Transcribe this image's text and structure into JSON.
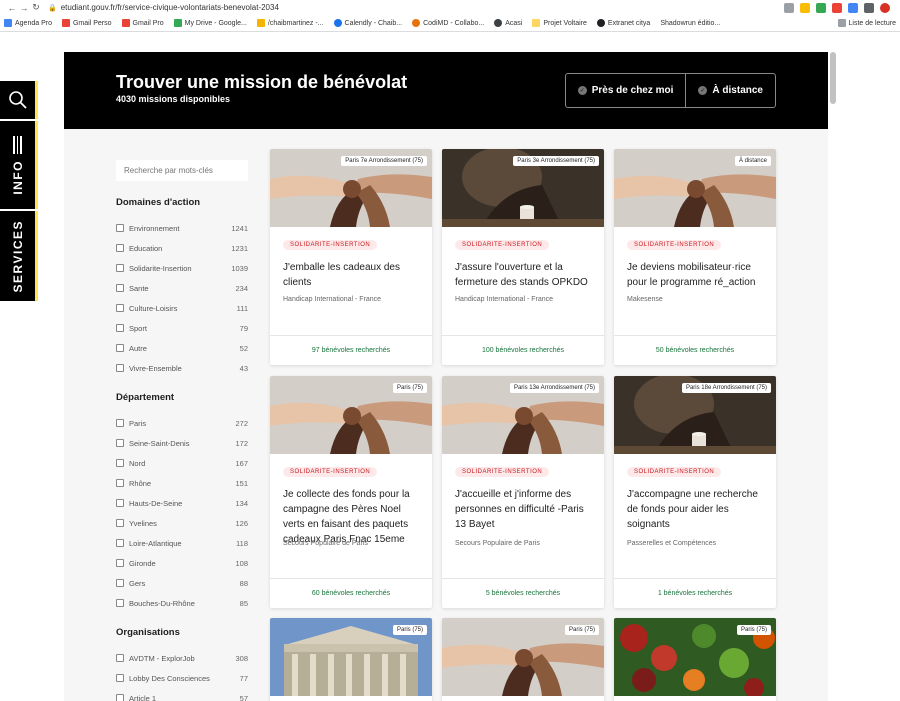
{
  "browser": {
    "url": "etudiant.gouv.fr/fr/service-civique-volontariats-benevolat-2034",
    "bookmarks": [
      "Agenda Pro",
      "Gmail Perso",
      "Gmail Pro",
      "My Drive - Google...",
      "/chaibmartinez -...",
      "Calendly - Chaib...",
      "CodiMD - Collabo...",
      "Acasi",
      "Projet Voltaire",
      "Extranet citya",
      "Shadowrun éditio..."
    ],
    "reading_list": "Liste de lecture"
  },
  "side_tabs": {
    "info": "INFO",
    "services": "SERVICES"
  },
  "hero": {
    "title": "Trouver une mission de bénévolat",
    "subtitle": "4030 missions disponibles",
    "toggle_near": "Près de chez moi",
    "toggle_remote": "À distance"
  },
  "filters": {
    "search_placeholder": "Recherche par mots-clés",
    "domaines": {
      "title": "Domaines d'action",
      "items": [
        {
          "label": "Environnement",
          "count": "1241"
        },
        {
          "label": "Education",
          "count": "1231"
        },
        {
          "label": "Solidarite-Insertion",
          "count": "1039"
        },
        {
          "label": "Sante",
          "count": "234"
        },
        {
          "label": "Culture-Loisirs",
          "count": "111"
        },
        {
          "label": "Sport",
          "count": "79"
        },
        {
          "label": "Autre",
          "count": "52"
        },
        {
          "label": "Vivre-Ensemble",
          "count": "43"
        }
      ]
    },
    "departement": {
      "title": "Département",
      "items": [
        {
          "label": "Paris",
          "count": "272"
        },
        {
          "label": "Seine-Saint-Denis",
          "count": "172"
        },
        {
          "label": "Nord",
          "count": "167"
        },
        {
          "label": "Rhône",
          "count": "151"
        },
        {
          "label": "Hauts-De-Seine",
          "count": "134"
        },
        {
          "label": "Yvelines",
          "count": "126"
        },
        {
          "label": "Loire-Atlantique",
          "count": "118"
        },
        {
          "label": "Gironde",
          "count": "108"
        },
        {
          "label": "Gers",
          "count": "88"
        },
        {
          "label": "Bouches-Du-Rhône",
          "count": "85"
        }
      ]
    },
    "organisations": {
      "title": "Organisations",
      "items": [
        {
          "label": "AVDTM - ExplorJob",
          "count": "308"
        },
        {
          "label": "Lobby Des Consciences",
          "count": "77"
        },
        {
          "label": "Article 1",
          "count": "57"
        }
      ]
    }
  },
  "cards": [
    {
      "location": "Paris 7e Arrondissement (75)",
      "tag": "SOLIDARITE-INSERTION",
      "title": "J'emballe les cadeaux des clients",
      "org": "Handicap International - France",
      "volunteers": "97 bénévoles recherchés",
      "image": "hands"
    },
    {
      "location": "Paris 3e Arrondissement (75)",
      "tag": "SOLIDARITE-INSERTION",
      "title": "J'assure l'ouverture et la fermeture des stands OPKDO",
      "org": "Handicap International - France",
      "volunteers": "100 bénévoles recherchés",
      "image": "sad"
    },
    {
      "location": "À distance",
      "tag": "SOLIDARITE-INSERTION",
      "title": "Je deviens mobilisateur·rice pour le programme ré_action",
      "org": "Makesense",
      "volunteers": "50 bénévoles recherchés",
      "image": "hands"
    },
    {
      "location": "Paris (75)",
      "tag": "SOLIDARITE-INSERTION",
      "title": "Je collecte des fonds pour la campagne des Pères Noel verts en faisant des paquets cadeaux Paris Fnac 15eme",
      "org": "Secours Populaire de Paris",
      "volunteers": "60 bénévoles recherchés",
      "image": "hands"
    },
    {
      "location": "Paris 13e Arrondissement (75)",
      "tag": "SOLIDARITE-INSERTION",
      "title": "J'accueille et j'informe des personnes en difficulté -Paris 13 Bayet",
      "org": "Secours Populaire de Paris",
      "volunteers": "5 bénévoles recherchés",
      "image": "hands"
    },
    {
      "location": "Paris 18e Arrondissement (75)",
      "tag": "SOLIDARITE-INSERTION",
      "title": "J'accompagne une recherche de fonds pour aider les soignants",
      "org": "Passerelles et Compétences",
      "volunteers": "1 bénévoles recherchés",
      "image": "sad"
    },
    {
      "location": "Paris (75)",
      "image": "building"
    },
    {
      "location": "Paris (75)",
      "image": "hands"
    },
    {
      "location": "Paris (75)",
      "image": "veg"
    }
  ],
  "colors": {
    "hero_bg": "#000000",
    "accent_yellow": "#ffe552",
    "tag_bg": "#fee9ea",
    "tag_text": "#c9191e",
    "volunteers_text": "#18753c"
  }
}
